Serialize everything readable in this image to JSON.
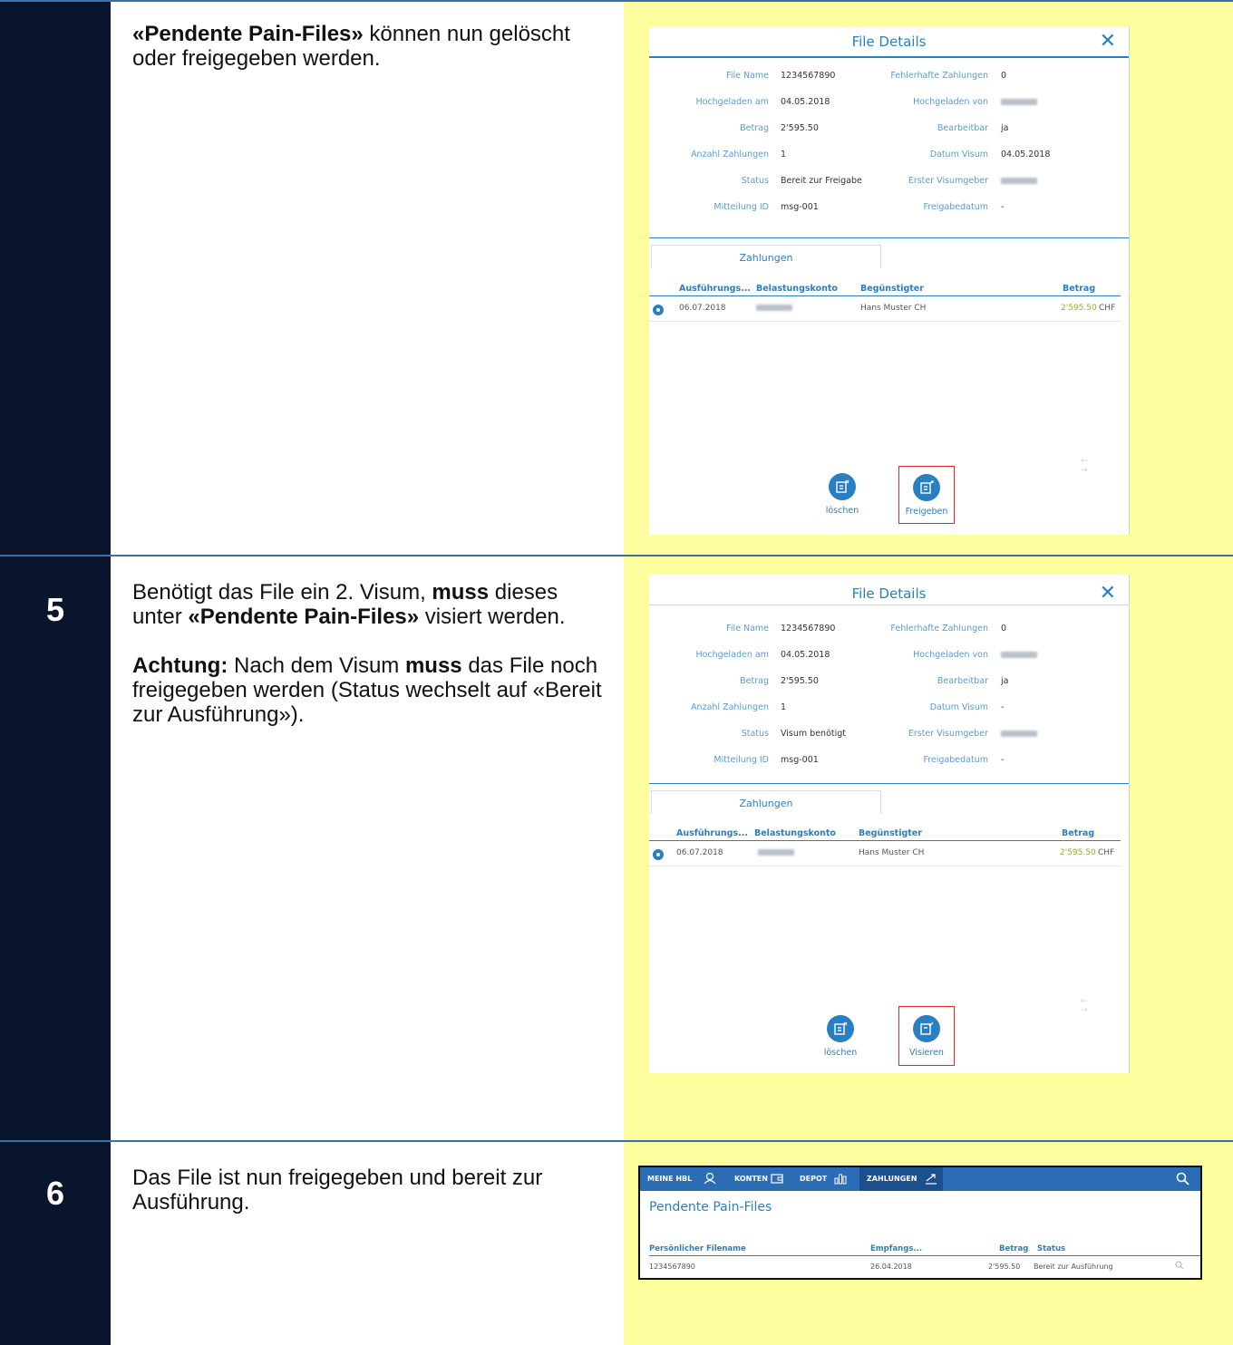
{
  "steps": [
    {
      "number": "",
      "paragraphs": [
        [
          {
            "text": "«Pendente Pain-Files»",
            "bold": true
          },
          {
            "text": " können nun gelöscht oder freigegeben werden.",
            "bold": false
          }
        ]
      ],
      "dialog": {
        "title": "File Details",
        "close": "✕",
        "details": [
          {
            "l1": "File Name",
            "v1": "1234567890",
            "l2": "Fehlerhafte Zahlungen",
            "v2": "0"
          },
          {
            "l1": "Hochgeladen am",
            "v1": "04.05.2018",
            "l2": "Hochgeladen von",
            "v2": ""
          },
          {
            "l1": "Betrag",
            "v1": "2'595.50",
            "l2": "Bearbeitbar",
            "v2": "ja"
          },
          {
            "l1": "Anzahl Zahlungen",
            "v1": "1",
            "l2": "Datum Visum",
            "v2": "04.05.2018"
          },
          {
            "l1": "Status",
            "v1": "Bereit zur Freigabe",
            "l2": "Erster Visumgeber",
            "v2": ""
          },
          {
            "l1": "Mitteilung ID",
            "v1": "msg-001",
            "l2": "Freigabedatum",
            "v2": "-"
          }
        ],
        "tab": "Zahlungen",
        "columns": {
          "exec": "Ausführungs...",
          "account": "Belastungskonto",
          "beneficiary": "Begünstigter",
          "amount": "Betrag"
        },
        "payment": {
          "date": "06.07.2018",
          "beneficiary": "Hans Muster CH",
          "amount": "2'595.50",
          "currency": "CHF"
        },
        "pager": "← →",
        "actions": [
          {
            "label": "löschen",
            "highlighted": false
          },
          {
            "label": "Freigeben",
            "highlighted": true
          }
        ]
      }
    },
    {
      "number": "5",
      "paragraphs": [
        [
          {
            "text": "Benötigt das File ein 2. Visum, ",
            "bold": false
          },
          {
            "text": "muss",
            "bold": true
          },
          {
            "text": " dieses unter ",
            "bold": false
          },
          {
            "text": "«Pendente Pain-Files»",
            "bold": true
          },
          {
            "text": " visiert werden.",
            "bold": false
          }
        ],
        [
          {
            "text": "Achtung:",
            "bold": true
          },
          {
            "text": " Nach dem Visum ",
            "bold": false
          },
          {
            "text": "muss",
            "bold": true
          },
          {
            "text": " das File noch freigegeben werden (Status wechselt auf «Bereit zur Ausführung»).",
            "bold": false
          }
        ]
      ],
      "dialog": {
        "title": "File Details",
        "close": "✕",
        "details": [
          {
            "l1": "File Name",
            "v1": "1234567890",
            "l2": "Fehlerhafte Zahlungen",
            "v2": "0"
          },
          {
            "l1": "Hochgeladen am",
            "v1": "04.05.2018",
            "l2": "Hochgeladen von",
            "v2": ""
          },
          {
            "l1": "Betrag",
            "v1": "2'595.50",
            "l2": "Bearbeitbar",
            "v2": "ja"
          },
          {
            "l1": "Anzahl Zahlungen",
            "v1": "1",
            "l2": "Datum Visum",
            "v2": "-"
          },
          {
            "l1": "Status",
            "v1": "Visum benötigt",
            "l2": "Erster Visumgeber",
            "v2": ""
          },
          {
            "l1": "Mitteilung ID",
            "v1": "msg-001",
            "l2": "Freigabedatum",
            "v2": "-"
          }
        ],
        "tab": "Zahlungen",
        "columns": {
          "exec": "Ausführungs...",
          "account": "Belastungskonto",
          "beneficiary": "Begünstigter",
          "amount": "Betrag"
        },
        "payment": {
          "date": "06.07.2018",
          "beneficiary": "Hans Muster CH",
          "amount": "2'595.50",
          "currency": "CHF"
        },
        "pager": "← →",
        "actions": [
          {
            "label": "löschen",
            "highlighted": false
          },
          {
            "label": "Visieren",
            "highlighted": true
          }
        ]
      }
    },
    {
      "number": "6",
      "paragraphs": [
        [
          {
            "text": "Das File ist nun freigegeben und bereit zur Ausführung.",
            "bold": false
          }
        ]
      ],
      "list": {
        "nav": [
          "MEINE HBL",
          "KONTEN",
          "DEPOT",
          "ZAHLUNGEN"
        ],
        "active_nav": "ZAHLUNGEN",
        "title": "Pendente Pain-Files",
        "columns": {
          "filename": "Persönlicher Filename",
          "received": "Empfangs...",
          "amount": "Betrag",
          "status": "Status"
        },
        "row": {
          "filename": "1234567890",
          "received": "26.04.2018",
          "amount": "2'595.50",
          "status": "Bereit zur Ausführung"
        }
      }
    }
  ],
  "colors": {
    "number_column": "#08152c",
    "screenshot_bg": "#fffe9f",
    "accent": "#2a7fc1",
    "highlight": "#e0292b",
    "amount_green": "#8fb02a"
  }
}
